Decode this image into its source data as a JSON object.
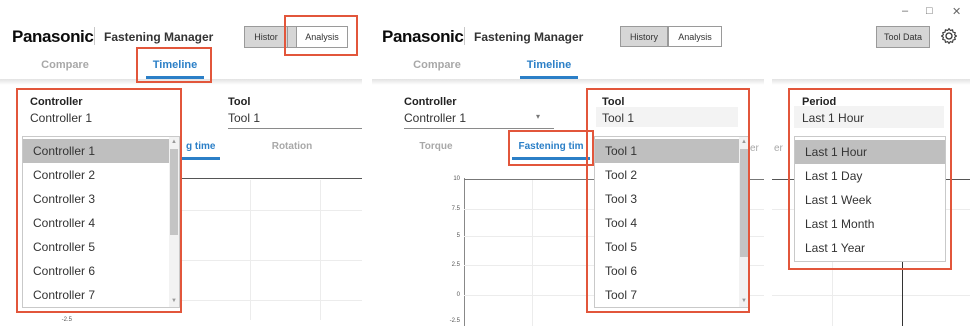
{
  "panel1": {
    "brand": "Panasonic",
    "app_title": "Fastening Manager",
    "seg_history": "Histor",
    "seg_analysis": "Analysis",
    "tabs": [
      {
        "label": "Compare"
      },
      {
        "label": "Timeline"
      }
    ],
    "controller_label": "Controller",
    "controller_value": "Controller 1",
    "tool_label": "Tool",
    "tool_value": "Tool 1",
    "subtabs": [
      {
        "label": "g time"
      },
      {
        "label": "Rotation"
      }
    ],
    "dropdown_items": [
      "Controller 1",
      "Controller 2",
      "Controller 3",
      "Controller 4",
      "Controller 5",
      "Controller 6",
      "Controller 7"
    ],
    "selected_index": 0,
    "bottom_tick": "-2.5"
  },
  "panel2": {
    "brand": "Panasonic",
    "app_title": "Fastening Manager",
    "seg_history": "History",
    "seg_analysis": "Analysis",
    "tabs": [
      {
        "label": "Compare"
      },
      {
        "label": "Timeline"
      }
    ],
    "controller_label": "Controller",
    "controller_value": "Controller 1",
    "tool_label": "Tool",
    "tool_value": "Tool 1",
    "subtabs": [
      {
        "label": "Torque"
      },
      {
        "label": "Fastening tim"
      }
    ],
    "y_ticks": [
      "10",
      "7.5",
      "5",
      "2.5",
      "0",
      "-2.5"
    ],
    "dropdown_items": [
      "Tool 1",
      "Tool 2",
      "Tool 3",
      "Tool 4",
      "Tool 5",
      "Tool 6",
      "Tool 7"
    ],
    "selected_index": 0,
    "partial_right": "er"
  },
  "panel3": {
    "window_controls": {
      "minimize": "–",
      "maximize": "□",
      "close": "✕"
    },
    "tool_data_button": "Tool Data",
    "settings_icon": "gear-icon",
    "period_label": "Period",
    "period_value": "Last 1 Hour",
    "dropdown_items": [
      "Last 1 Hour",
      "Last 1 Day",
      "Last 1 Week",
      "Last 1 Month",
      "Last 1 Year"
    ],
    "selected_index": 0,
    "partial_left": "er"
  },
  "colors": {
    "accent_blue": "#2b7fc7",
    "highlight_red": "#e2563b",
    "selected_gray": "#bfbfbf"
  }
}
